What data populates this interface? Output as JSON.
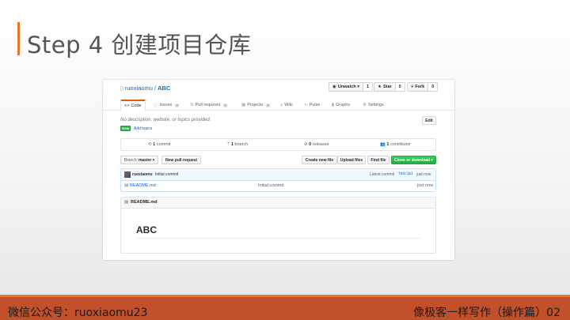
{
  "slide": {
    "title": "Step 4 创建项目仓库",
    "footer_left": "微信公众号：ruoxiaomu23",
    "footer_right": "像极客一样写作（操作篇）02"
  },
  "repo": {
    "owner": "ruoxiaomu",
    "separator": "/",
    "name": "ABC",
    "unwatch_label": "Unwatch ▾",
    "unwatch_count": "1",
    "star_label": "Star",
    "star_count": "0",
    "fork_label": "Fork",
    "fork_count": "0"
  },
  "tabs": [
    {
      "label": "Code",
      "icon": "<>"
    },
    {
      "label": "Issues",
      "count": "0",
      "icon": "ⓘ"
    },
    {
      "label": "Pull requests",
      "count": "0",
      "icon": "⇅"
    },
    {
      "label": "Projects",
      "count": "0",
      "icon": "▦"
    },
    {
      "label": "Wiki",
      "icon": "≡"
    },
    {
      "label": "Pulse",
      "icon": "∿"
    },
    {
      "label": "Graphs",
      "icon": "▮"
    },
    {
      "label": "Settings",
      "icon": "⚙"
    }
  ],
  "about": {
    "description": "No description, website, or topics provided.",
    "new_badge": "New",
    "add_topics": "Add topics",
    "edit_label": "Edit"
  },
  "summary": {
    "commits_count": "1",
    "commits_label": "commit",
    "branches_count": "1",
    "branches_label": "branch",
    "releases_count": "0",
    "releases_label": "releases",
    "contributors_count": "1",
    "contributors_label": "contributor"
  },
  "toolbar": {
    "branch_prefix": "Branch:",
    "branch_name": "master ▾",
    "new_pr": "New pull request",
    "create_file": "Create new file",
    "upload_files": "Upload files",
    "find_file": "Find file",
    "clone": "Clone or download ▾"
  },
  "latest_commit": {
    "author": "ruoxiaomu",
    "message": "Initial commit",
    "label": "Latest commit",
    "sha": "fd4c1b1",
    "time": "just now"
  },
  "files": [
    {
      "name": "README.md",
      "message": "Initial commit",
      "time": "just now"
    }
  ],
  "readme": {
    "header": "README.md",
    "heading": "ABC"
  },
  "colors": {
    "accent": "#e8742a",
    "footer_bg": "#c2502a",
    "link": "#0366d6",
    "green": "#28a745"
  }
}
